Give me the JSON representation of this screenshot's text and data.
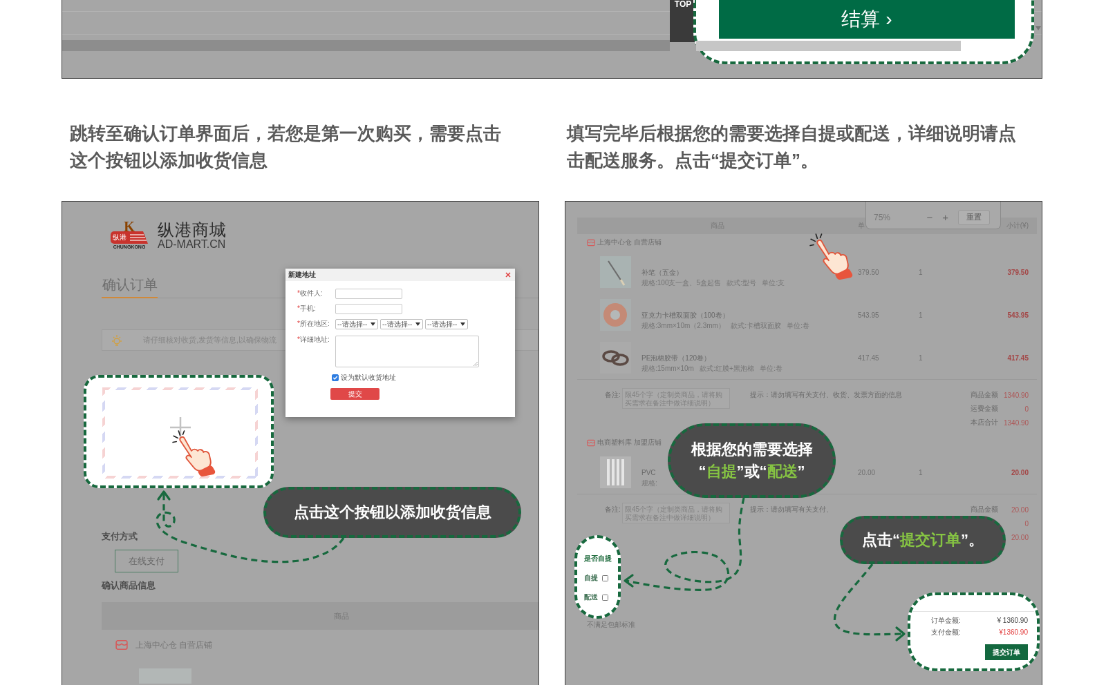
{
  "top_panel": {
    "top_button": "TOP",
    "checkout_button": "结算 ›"
  },
  "steps": [
    {
      "caption": "跳转至确认订单界面后，若您是第一次购买，需要点击这个按钮以添加收货信息"
    },
    {
      "caption": "填写完毕后根据您的需要选择自提或配送，详细说明请点击配送服务。点击“提交订单”。"
    }
  ],
  "left_panel": {
    "logo": {
      "letter": "K",
      "badge": "纵港",
      "brand": "CHUNGKONG",
      "name": "纵港商城",
      "domain": "AD-MART.CN"
    },
    "page_title": "确认订单",
    "notice": "请仔细核对收货,发货等信息,以确保物流",
    "dialog": {
      "title": "新建地址",
      "fields": [
        {
          "kind": "input",
          "label": "*收件人:"
        },
        {
          "kind": "input",
          "label": "*手机:"
        },
        {
          "kind": "select",
          "label": "*所在地区:",
          "values": [
            "--请选择--",
            "--请选择--",
            "--请选择--"
          ]
        },
        {
          "kind": "textarea",
          "label": "*详细地址:"
        }
      ],
      "default_address": {
        "label": "设为默认收货地址",
        "checked": true
      },
      "submit": "提交"
    },
    "callout": "点击这个按钮以添加收货信息",
    "payment": {
      "heading": "支付方式",
      "options": [
        {
          "label": "在线支付",
          "selected": true
        }
      ]
    },
    "goods_heading": "确认商品信息",
    "table_header": "商品",
    "store": "上海中心仓 自营店铺"
  },
  "right_panel": {
    "table_header": [
      "商品",
      "单",
      "小计(¥)"
    ],
    "zoom_control": {
      "value": "75%",
      "buttons": [
        "−",
        "+",
        "重置"
      ]
    },
    "stores": [
      {
        "name": "上海中心仓 自营店铺",
        "items": [
          {
            "kind": "pen",
            "name": "补笔（五金）",
            "spec": "规格:100支一盒、5盒起售   款式:型号   单位:支",
            "price": "379.50",
            "qty": "1",
            "subtotal": "379.50"
          },
          {
            "kind": "tape",
            "name": "亚克力卡槽双面胶（100卷）",
            "spec": "规格:3mm×10m（2.3mm）   款式:卡槽双面胶   单位:卷",
            "price": "543.95",
            "qty": "1",
            "subtotal": "543.95"
          },
          {
            "kind": "rolls",
            "name": "PE泡棉胶带（120卷）",
            "spec": "规格:15mm×10m   款式:红膜+黑泡棉   单位:卷",
            "price": "417.45",
            "qty": "1",
            "subtotal": "417.45"
          }
        ],
        "note": {
          "label": "备注:",
          "placeholder": "限45个字（定制类商品，请将购买需求在备注中做详细说明）",
          "hint": "提示：请勿填写有关支付、收货、发票方面的信息"
        },
        "summary": [
          {
            "label": "商品金额",
            "value": "1340.90"
          },
          {
            "label": "运费金额",
            "value": "0"
          },
          {
            "label": "本店合计",
            "value": "1340.90"
          }
        ]
      },
      {
        "name": "电商塑料库 加盟店铺",
        "items": [
          {
            "kind": "strips",
            "name": "PVC",
            "spec": "规格:",
            "price": "20.00",
            "qty": "1",
            "subtotal": "20.00"
          }
        ],
        "note": {
          "label": "备注:",
          "placeholder": "限45个字（定制类商品，请将购买需求在备注中做详细说明）",
          "hint": "提示：请勿填写有关支付、"
        },
        "summary": [
          {
            "label": "商品金额",
            "value": "20.00"
          },
          {
            "value": "0"
          },
          {
            "value": "20.00"
          }
        ]
      }
    ],
    "choice_callout": "根据您的需要选择“**自提**”或“**配送**”",
    "delivery": {
      "heading": "是否自提",
      "options": [
        {
          "label": "自提",
          "checked": false
        },
        {
          "label": "配送",
          "checked": false
        }
      ],
      "note": "不满足包邮标准"
    },
    "submit_callout": "点击“**提交订单**”。",
    "order_summary": {
      "rows": [
        {
          "kind": "total",
          "label": "订单金额:",
          "value": "¥ 1360.90"
        },
        {
          "kind": "due",
          "label": "支付金额:",
          "value": "¥1360.90"
        }
      ],
      "submit": "提交订单"
    }
  }
}
